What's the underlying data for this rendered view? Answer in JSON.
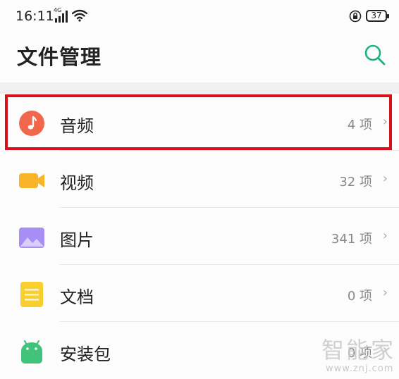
{
  "status_bar": {
    "time": "16:11",
    "network_tag": "4G",
    "battery": "37"
  },
  "header": {
    "title": "文件管理"
  },
  "items": [
    {
      "label": "音频",
      "count": "4 项",
      "icon": "audio-icon",
      "color": "#f0674b"
    },
    {
      "label": "视频",
      "count": "32 项",
      "icon": "video-icon",
      "color": "#f8b52a"
    },
    {
      "label": "图片",
      "count": "341 项",
      "icon": "image-icon",
      "color": "#a78ef5"
    },
    {
      "label": "文档",
      "count": "0 项",
      "icon": "document-icon",
      "color": "#f9cf2f"
    },
    {
      "label": "安装包",
      "count": "0 项",
      "icon": "package-icon",
      "color": "#40c47b"
    }
  ],
  "chevron": "›",
  "watermark": {
    "name": "智能家",
    "url": "www.znj.com"
  },
  "colors": {
    "accent": "#1bb382",
    "highlight": "#d9101c"
  }
}
